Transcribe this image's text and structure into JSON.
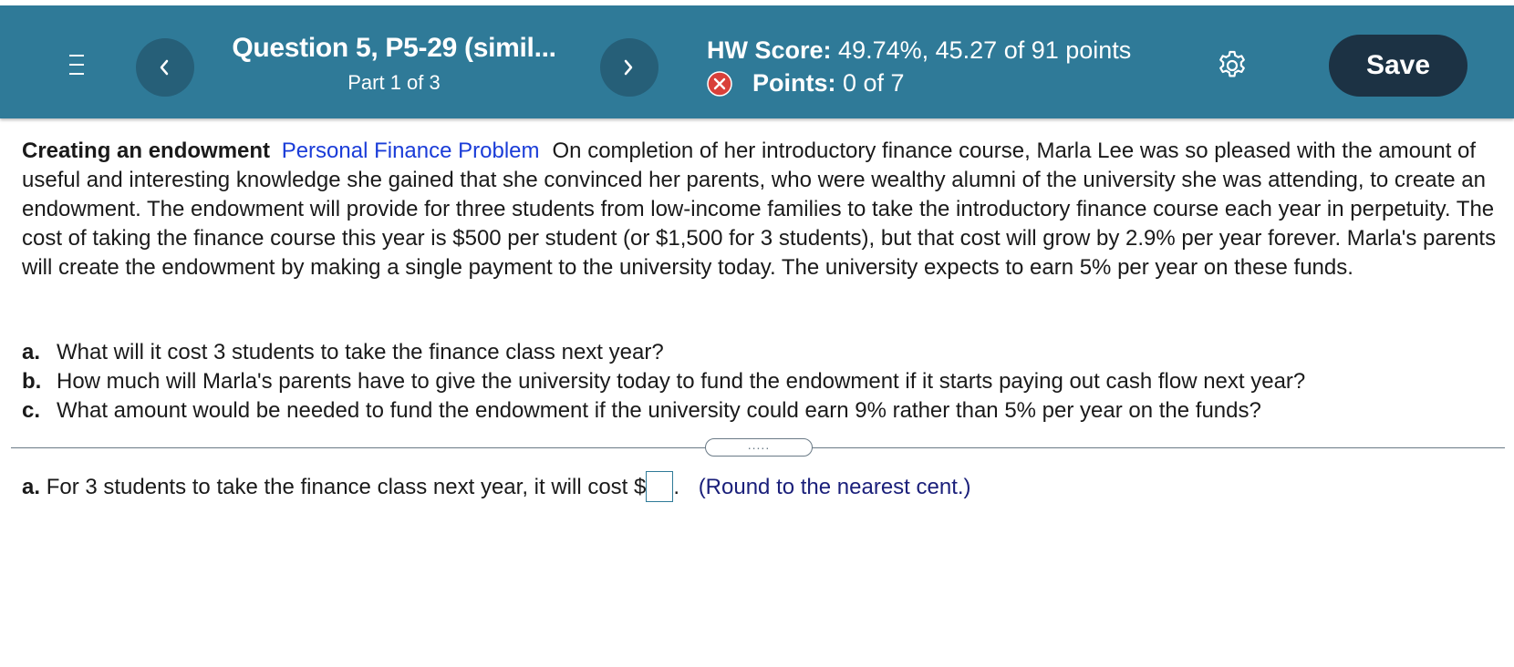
{
  "header": {
    "question_title": "Question 5, P5-29 (simil...",
    "part": "Part 1 of 3",
    "hw_score_label": "HW Score:",
    "hw_score_value": "49.74%, 45.27 of 91 points",
    "points_label": "Points:",
    "points_value": "0 of 7",
    "save_label": "Save"
  },
  "icons": {
    "menu": "hamburger-menu-icon",
    "prev": "chevron-left-icon",
    "next": "chevron-right-icon",
    "status": "x-circle-icon",
    "settings": "gear-icon"
  },
  "colors": {
    "header_bg": "#2f7a98",
    "nav_button_bg": "#265f78",
    "save_button_bg": "#1c3244",
    "incorrect_red": "#d9403a",
    "link_blue": "#1a3cd8"
  },
  "problem": {
    "topic": "Creating an endowment",
    "category": "Personal Finance Problem",
    "text": "On completion of her introductory finance course, Marla Lee was so pleased with the amount of useful and interesting knowledge she gained that she convinced her parents, who were wealthy alumni of the university she was attending, to create an endowment.  The endowment will provide for three  students from low-income families to take the introductory finance course each year in perpetuity.  The cost of taking the finance course this year is $500 per student (or $1,500 for 3 students), but that cost will grow by 2.9% per year forever. Marla's parents will create the endowment by making a single payment to the university today. The university expects to earn 5% per year on these funds."
  },
  "questions": [
    {
      "label": "a.",
      "text": "What will it cost 3 students to take the finance class next year?"
    },
    {
      "label": "b.",
      "text": "How much will Marla's parents have to give the university today to fund the endowment if it starts paying out cash flow next year?"
    },
    {
      "label": "c.",
      "text": "What amount would be needed to fund the endowment if the university could earn 9% rather than 5% per year on the funds?"
    }
  ],
  "divider_handle": ".....",
  "answer": {
    "label": "a.",
    "prefix": "For 3 students to take the finance class next year, it will cost $",
    "value": "",
    "suffix": ".",
    "hint": "(Round to the nearest cent.)"
  }
}
